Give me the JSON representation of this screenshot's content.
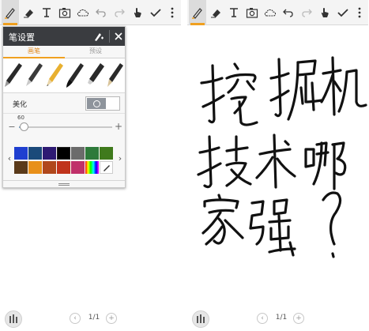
{
  "toolbar": {
    "items": [
      {
        "name": "pen-icon",
        "label": "pen"
      },
      {
        "name": "eraser-icon",
        "label": "eraser"
      },
      {
        "name": "text-icon",
        "label": "text"
      },
      {
        "name": "camera-icon",
        "label": "image"
      },
      {
        "name": "cloud-icon",
        "label": "shape"
      },
      {
        "name": "undo-icon",
        "label": "undo"
      },
      {
        "name": "redo-icon",
        "label": "redo"
      },
      {
        "name": "hand-icon",
        "label": "select"
      },
      {
        "name": "check-icon",
        "label": "done"
      },
      {
        "name": "more-icon",
        "label": "more"
      }
    ],
    "active_index": 0,
    "accent_color": "#f0a020"
  },
  "pen_settings": {
    "title": "笔设置",
    "tabs": [
      {
        "label": "画笔",
        "selected": true
      },
      {
        "label": "预设",
        "selected": false
      }
    ],
    "pens": [
      {
        "name": "fountain-pen-icon",
        "color": "#2a2a2a"
      },
      {
        "name": "calligraphy-pen-icon",
        "color": "#2a2a2a"
      },
      {
        "name": "pencil-icon",
        "color": "#e8b030"
      },
      {
        "name": "brush-pen-icon",
        "color": "#2a2a2a"
      },
      {
        "name": "marker-icon",
        "color": "#2a2a2a"
      },
      {
        "name": "ink-pen-icon",
        "color": "#2a2a2a"
      }
    ],
    "beautify_label": "美化",
    "beautify_on": true,
    "size_value": "60",
    "size_fraction": 0.05,
    "size_minus": "−",
    "size_plus": "+",
    "palette_prev": "‹",
    "palette_next": "›",
    "palette": [
      "#1f3fd0",
      "#1b4a7a",
      "#2e1a73",
      "#000000",
      "#6b6b6b",
      "#2e7a3a",
      "#3f7a1c",
      "#5a3a1a",
      "#e8901a",
      "#b0481c",
      "#c0341c",
      "#c0306a",
      "rainbow",
      "eyedropper"
    ],
    "selected_color_index": 3
  },
  "pager": {
    "left_text": "1/1",
    "right_text": "1/1",
    "prev": "‹",
    "add": "+"
  },
  "handwriting": {
    "lines": [
      "挖掘机",
      "技术哪",
      "家强?"
    ]
  }
}
